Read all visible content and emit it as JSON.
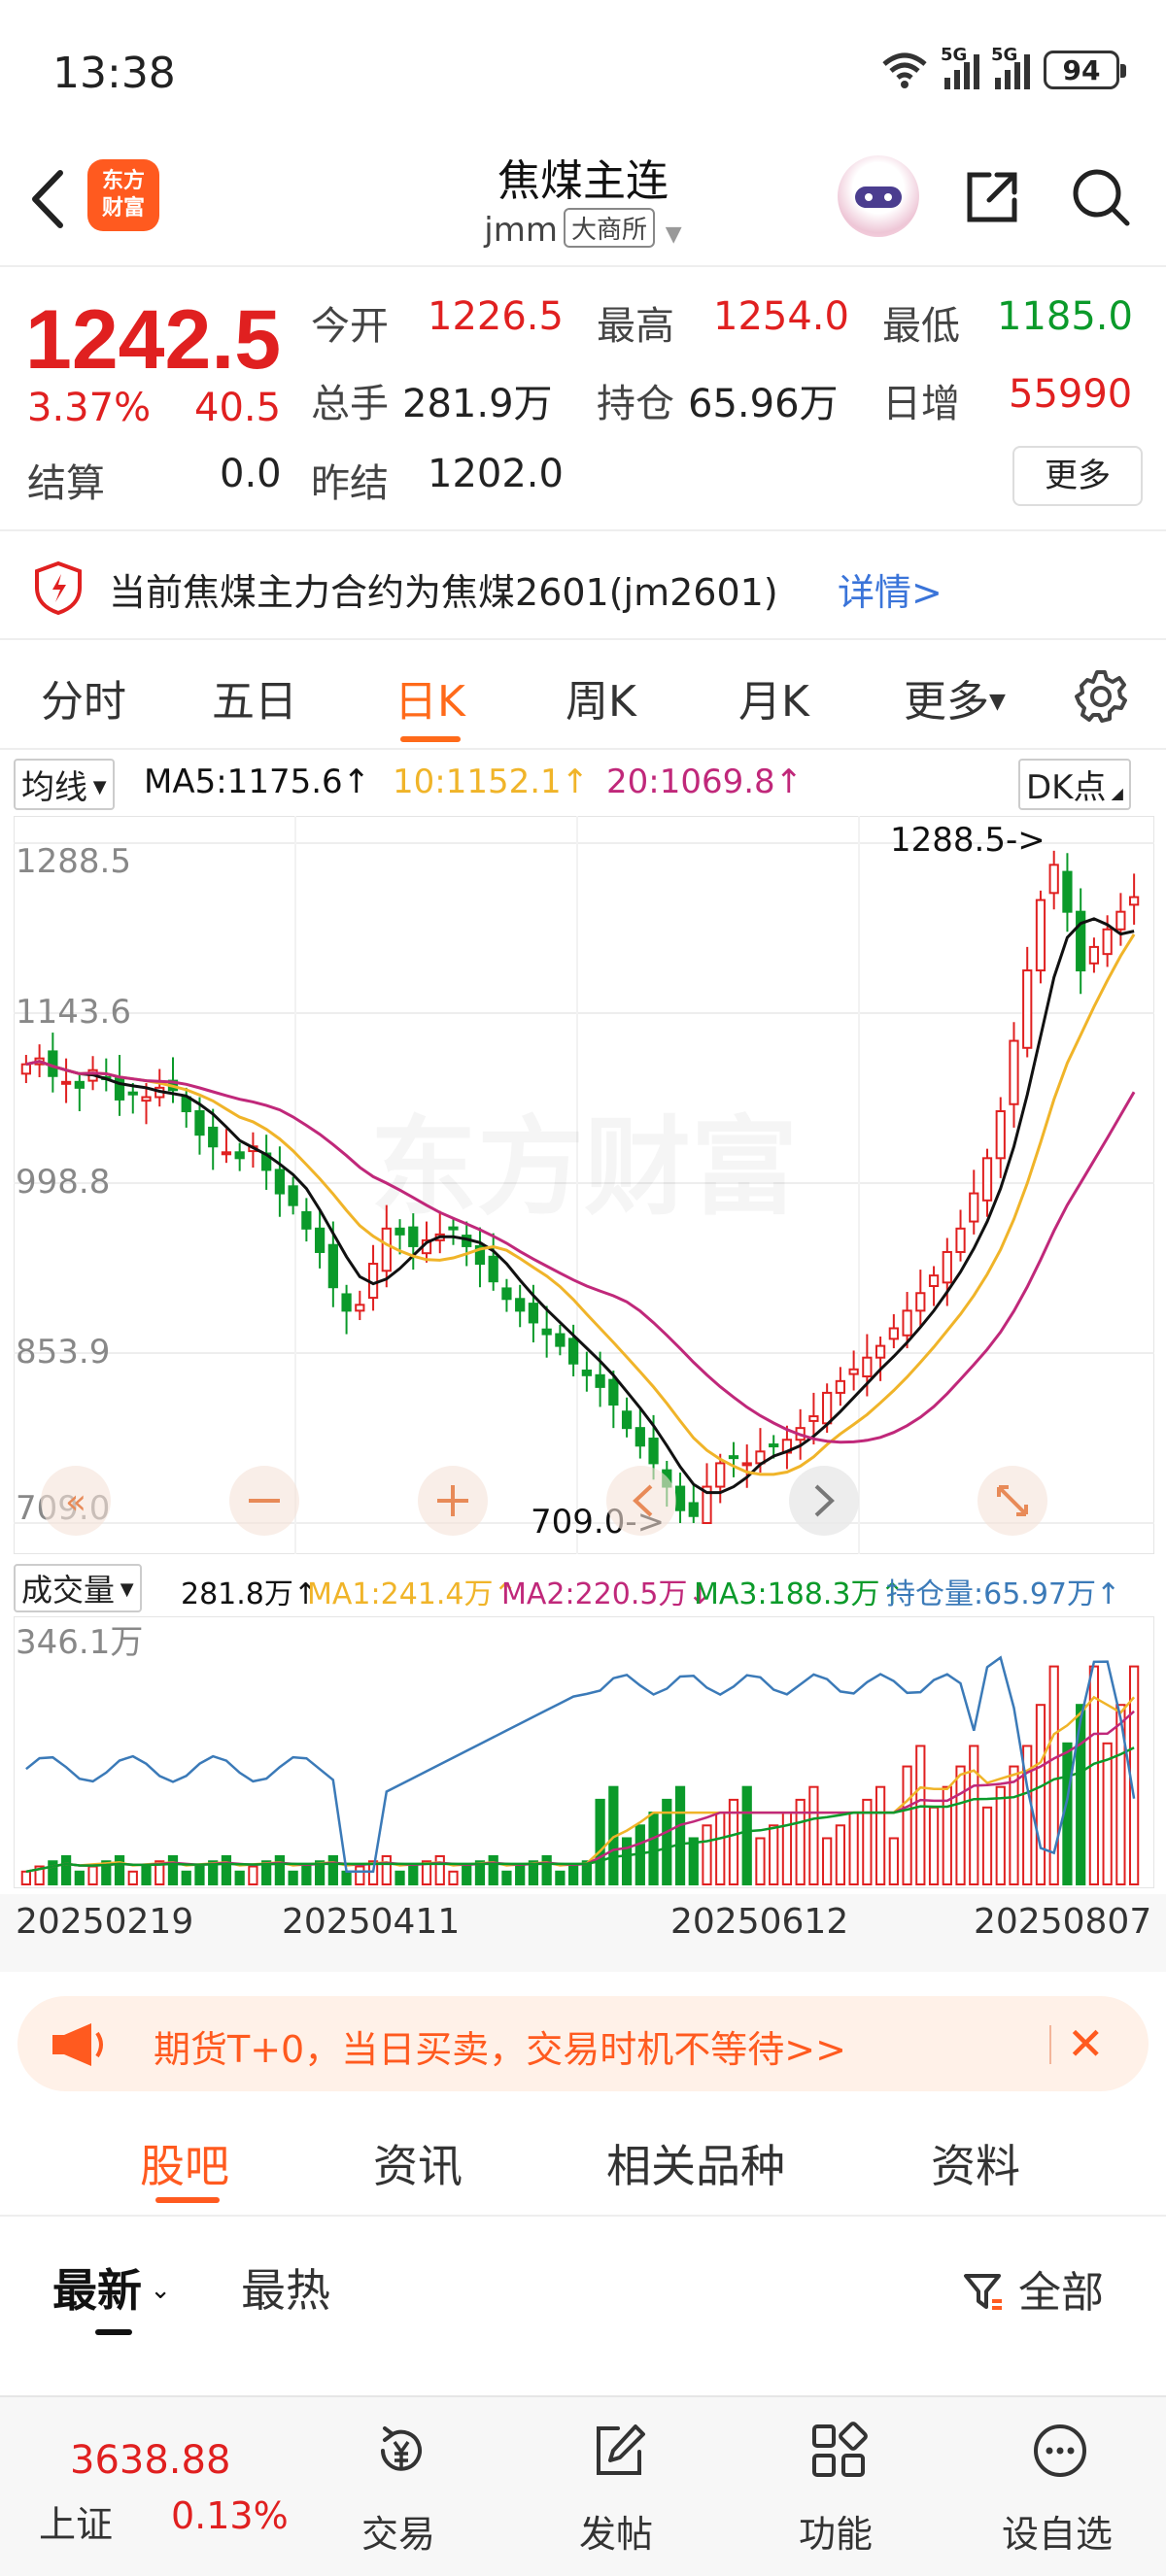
{
  "status": {
    "time": "13:38",
    "battery": "94",
    "net1": "5G",
    "net2": "5G"
  },
  "header": {
    "logo_text_1": "东方",
    "logo_text_2": "财富",
    "title": "焦煤主连",
    "symbol": "jmm",
    "exchange": "大商所"
  },
  "quote": {
    "price": "1242.5",
    "change_pct": "3.37%",
    "change_amt": "40.5",
    "settle_label": "结算",
    "settle_value": "0.0",
    "open_label": "今开",
    "open_value": "1226.5",
    "high_label": "最高",
    "high_value": "1254.0",
    "low_label": "最低",
    "low_value": "1185.0",
    "volume_label": "总手",
    "volume_value": "281.9万",
    "oi_label": "持仓",
    "oi_value": "65.96万",
    "daily_inc_label": "日增",
    "daily_inc_value": "55990",
    "prev_settle_label": "昨结",
    "prev_settle_value": "1202.0",
    "more_label": "更多"
  },
  "notice": {
    "text": "当前焦煤主力合约为焦煤2601(jm2601)",
    "link": "详情>"
  },
  "period_tabs": [
    "分时",
    "五日",
    "日K",
    "周K",
    "月K",
    "更多"
  ],
  "active_period": "日K",
  "ma_legend": {
    "selector": "均线",
    "ma5": "MA5:1175.6↑",
    "ma10": "10:1152.1↑",
    "ma20": "20:1069.8↑",
    "dk": "DK点"
  },
  "vol_legend": {
    "selector": "成交量",
    "vol": "281.8万↑",
    "ma1": "MA1:241.4万↑",
    "ma2": "MA2:220.5万↓",
    "ma3": "MA3:188.3万↑",
    "oi": "持仓量:65.97万↑"
  },
  "watermark": "东方财富",
  "colors": {
    "up": "#e02020",
    "down": "#0b9a2a",
    "ma5": "#111111",
    "ma10": "#f0b429",
    "ma20": "#c0287a",
    "oi_line": "#3b7ab8",
    "accent": "#ff6a1a"
  },
  "chart_data": {
    "type": "candlestick",
    "y_ticks": [
      "1288.5",
      "1143.6",
      "998.8",
      "853.9",
      "709.0"
    ],
    "ylim": [
      709.0,
      1288.5
    ],
    "max_marker": "1288.5->",
    "min_marker": "709.0->",
    "volume_max_label": "346.1万",
    "x_ticks": [
      "20250219",
      "20250411",
      "20250612",
      "20250807"
    ],
    "close_series": [
      1100,
      1105,
      1090,
      1085,
      1080,
      1095,
      1088,
      1070,
      1075,
      1072,
      1080,
      1078,
      1060,
      1040,
      1030,
      1025,
      1020,
      1030,
      1010,
      990,
      980,
      960,
      940,
      910,
      890,
      895,
      930,
      960,
      955,
      945,
      950,
      955,
      960,
      945,
      930,
      915,
      900,
      890,
      880,
      870,
      860,
      845,
      835,
      825,
      810,
      790,
      775,
      760,
      740,
      720,
      715,
      740,
      760,
      765,
      760,
      770,
      775,
      780,
      790,
      800,
      820,
      830,
      840,
      850,
      860,
      875,
      890,
      905,
      920,
      940,
      960,
      990,
      1020,
      1060,
      1120,
      1180,
      1240,
      1270,
      1230,
      1180,
      1200,
      1215,
      1230,
      1242.5
    ]
  },
  "promo": {
    "text": "期货T+0，当日买卖，交易时机不等待>>"
  },
  "content_tabs": [
    "股吧",
    "资讯",
    "相关品种",
    "资料"
  ],
  "sort": {
    "newest": "最新",
    "hot": "最热",
    "filter": "全部"
  },
  "bottom_nav": {
    "index_value": "3638.88",
    "index_name": "上证",
    "index_change": "0.13%",
    "trade": "交易",
    "post": "发帖",
    "functions": "功能",
    "watchlist": "设自选"
  }
}
